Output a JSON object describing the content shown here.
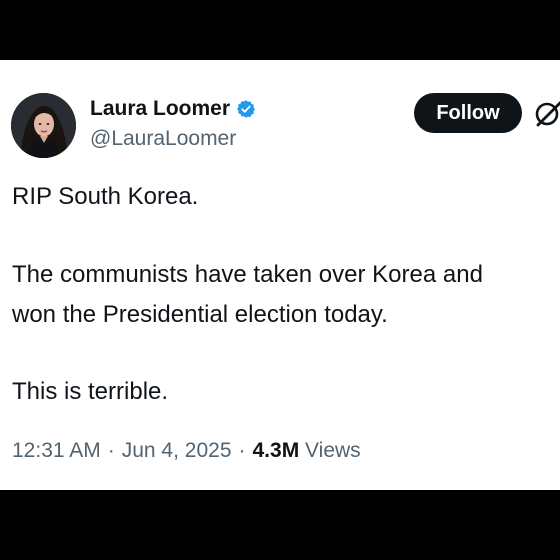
{
  "author": {
    "display_name": "Laura Loomer",
    "handle": "@LauraLoomer",
    "verified_icon": "verified-badge-icon",
    "avatar_icon": "profile-photo"
  },
  "actions": {
    "follow_label": "Follow",
    "grok_icon": "grok-icon"
  },
  "tweet": {
    "lines": [
      "RIP South Korea.",
      "The communists have taken over Korea and",
      "won the Presidential election today.",
      "This is terrible."
    ]
  },
  "meta": {
    "time": "12:31 AM",
    "separator": "·",
    "date": "Jun 4, 2025",
    "views_count": "4.3M",
    "views_label": "Views"
  },
  "colors": {
    "background_frame": "#000000",
    "card": "#ffffff",
    "text_primary": "#0f1419",
    "text_secondary": "#536471",
    "verified_blue": "#1d9bf0",
    "follow_button": "#0f1419"
  }
}
